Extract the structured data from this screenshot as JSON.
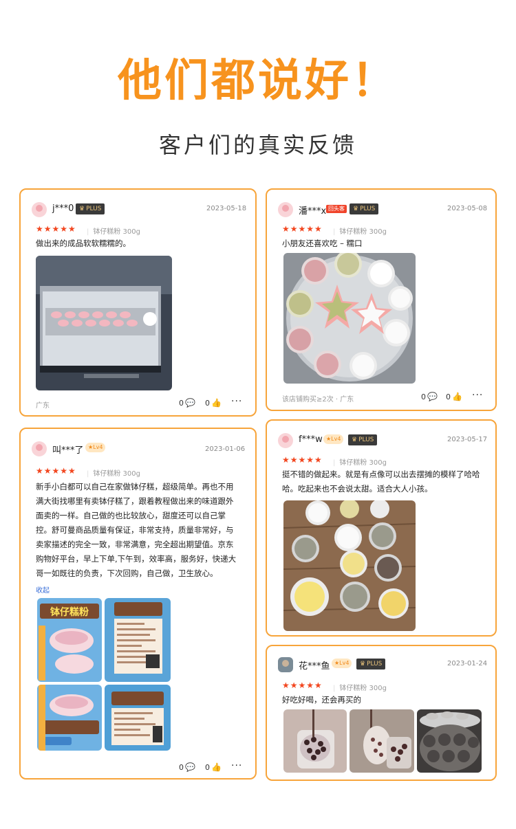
{
  "header": {
    "title": "他们都说好！",
    "subtitle": "客户们的真实反馈"
  },
  "reviews": [
    {
      "user": "j***0",
      "plus": "PLUS",
      "date": "2023-05-18",
      "stars": "★★★★★",
      "spec": "钵仔糕粉 300g",
      "text": "做出来的成品软软糯糯的。",
      "location": "广东",
      "comments": "0",
      "likes": "0"
    },
    {
      "user": "潘***x",
      "badge": "回头客",
      "plus": "PLUS",
      "date": "2023-05-08",
      "stars": "★★★★★",
      "spec": "钵仔糕粉 300g",
      "text": "小朋友还喜欢吃 – 糯口",
      "purchase": "该店铺购买≥2次 · 广东",
      "comments": "0",
      "likes": "0"
    },
    {
      "user": "叫***了",
      "level": "★Lv4",
      "date": "2023-01-06",
      "stars": "★★★★★",
      "spec": "钵仔糕粉 300g",
      "text_lines": [
        "新手小白都可以自己在家做钵仔糕，超级简单。再也不用",
        "满大街找哪里有卖钵仔糕了，跟着教程做出来的味道跟外",
        "面卖的一样。自己做的也比较放心，甜度还可以自己掌",
        "控。舒可曼商品质量有保证，非常支持，质量非常好，与",
        "卖家描述的完全一致，非常满意，完全超出期望值。京东",
        "购物好平台，早上下单,下午到，效率高，服务好，快递大",
        "哥一如既往的负责，下次回购，自己做，卫生放心。"
      ],
      "collapse": "收起",
      "comments": "0",
      "likes": "0",
      "packaging_text": "钵仔糕粉"
    },
    {
      "user": "f***w",
      "level": "★Lv4",
      "plus": "PLUS",
      "date": "2023-05-17",
      "stars": "★★★★★",
      "spec": "钵仔糕粉 300g",
      "text_lines": [
        "挺不错的做起来。就是有点像可以出去摆摊的模样了哈哈",
        "哈。吃起来也不会说太甜。适合大人小孩。"
      ]
    },
    {
      "user": "花***鱼",
      "level": "★Lv4",
      "plus": "PLUS",
      "date": "2023-01-24",
      "stars": "★★★★★",
      "spec": "钵仔糕粉 300g",
      "text": "好吃好喝，还会再买的"
    }
  ],
  "icons": {
    "comment": "comment-bubble-icon",
    "like": "thumbs-up-icon",
    "more": "more-dots-icon"
  },
  "colors": {
    "accent": "#f7931e",
    "star": "#f2461f",
    "border": "#f7a43a",
    "link": "#3a6fd8"
  }
}
